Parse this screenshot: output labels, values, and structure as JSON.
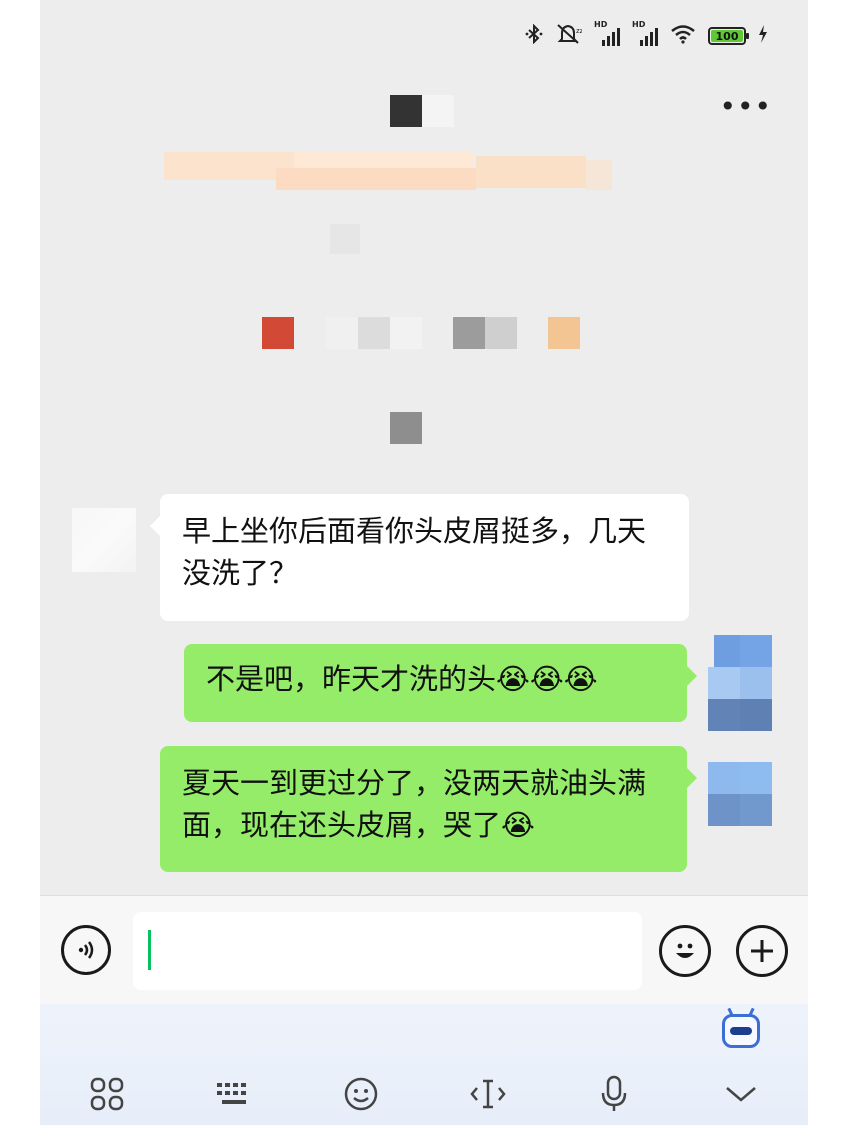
{
  "status_bar": {
    "battery": "100",
    "signal_label": "HD",
    "icons": [
      "bluetooth-icon",
      "mute-icon",
      "signal-icon",
      "signal-icon",
      "wifi-icon",
      "battery-icon",
      "charging-icon"
    ]
  },
  "header": {
    "more_icon": "more-icon"
  },
  "messages": [
    {
      "side": "left",
      "text": "早上坐你后面看你头皮屑挺多，几天没洗了？"
    },
    {
      "side": "right",
      "text": "不是吧，昨天才洗的头😭😭😭"
    },
    {
      "side": "right",
      "text": "夏天一到更过分了，没两天就油头满面，现在还头皮屑，哭了😭"
    }
  ],
  "input_bar": {
    "value": "",
    "icons": [
      "voice-icon",
      "emoji-icon",
      "add-icon"
    ]
  },
  "keyboard_toolbar": {
    "icons": [
      "apps-icon",
      "keyboard-icon",
      "emoji-icon",
      "cursor-icon",
      "microphone-icon",
      "collapse-icon",
      "assistant-robot-icon"
    ]
  },
  "colors": {
    "bubble_self": "#95ec69",
    "bubble_other": "#ffffff",
    "chat_bg": "#ededed",
    "caret": "#07c160"
  }
}
